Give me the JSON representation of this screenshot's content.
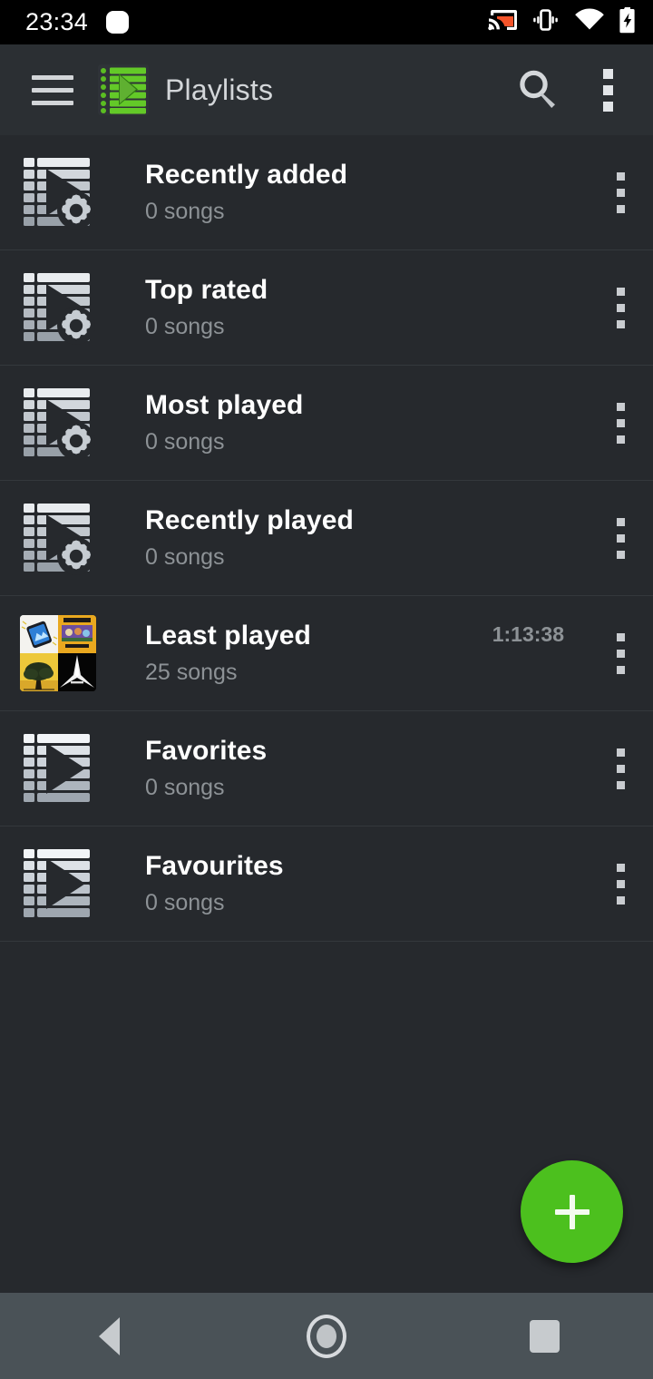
{
  "status_bar": {
    "time": "23:34",
    "icons": [
      "notification-dot",
      "cast-icon",
      "vibrate-icon",
      "wifi-icon",
      "battery-charging-icon"
    ]
  },
  "toolbar": {
    "menu_icon": "hamburger-icon",
    "app_icon": "playlist-app-icon",
    "title": "Playlists",
    "search_icon": "search-icon",
    "overflow_icon": "overflow-menu-icon"
  },
  "playlists": [
    {
      "title": "Recently added",
      "subtitle": "0 songs",
      "duration": "",
      "icon": "smart-playlist-icon"
    },
    {
      "title": "Top rated",
      "subtitle": "0 songs",
      "duration": "",
      "icon": "smart-playlist-icon"
    },
    {
      "title": "Most played",
      "subtitle": "0 songs",
      "duration": "",
      "icon": "smart-playlist-icon"
    },
    {
      "title": "Recently played",
      "subtitle": "0 songs",
      "duration": "",
      "icon": "smart-playlist-icon"
    },
    {
      "title": "Least played",
      "subtitle": "25 songs",
      "duration": "1:13:38",
      "icon": "album-art-mosaic"
    },
    {
      "title": "Favorites",
      "subtitle": "0 songs",
      "duration": "",
      "icon": "playlist-icon"
    },
    {
      "title": "Favourites",
      "subtitle": "0 songs",
      "duration": "",
      "icon": "playlist-icon"
    }
  ],
  "fab": {
    "label": "+",
    "icon": "plus-icon",
    "color": "#4cc01e"
  },
  "nav_bar": {
    "back": "back-icon",
    "home": "home-icon",
    "recents": "recents-icon"
  },
  "colors": {
    "accent": "#4cc01e",
    "background": "#26292d",
    "toolbar": "#2b2f33",
    "status_bar": "#000000",
    "nav_bar": "#4a5257",
    "title_text": "#ffffff",
    "subtitle_text": "#8d9296"
  }
}
